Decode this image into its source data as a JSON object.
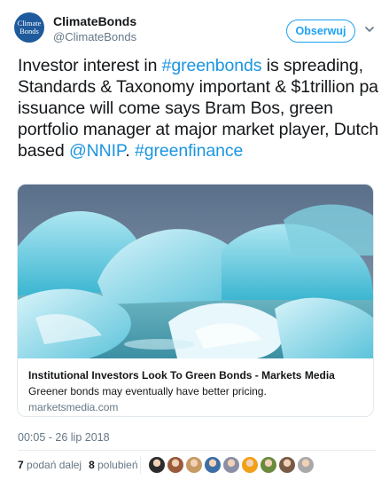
{
  "author": {
    "avatar_text_line1": "Climate",
    "avatar_text_line2": "Bonds",
    "display_name": "ClimateBonds",
    "handle": "@ClimateBonds"
  },
  "follow_button": {
    "label": "Obserwuj"
  },
  "menu_icon": "chevron-down-icon",
  "tweet": {
    "text_1": "Investor interest in ",
    "hashtag_1": "#greenbonds",
    "text_2": " is spreading, Standards & Taxonomy important & $1trillion pa issuance will come says Bram Bos, green portfolio manager at major market player, Dutch based ",
    "mention": "@NNIP",
    "text_3": ". ",
    "hashtag_2": "#greenfinance"
  },
  "link_card": {
    "title": "Institutional Investors Look To Green Bonds - Markets Media",
    "description": "Greener bonds may eventually have better pricing.",
    "domain": "marketsmedia.com"
  },
  "timestamp": "00:05 - 26 lip 2018",
  "stats": {
    "retweets_count": "7",
    "retweets_label": "podań dalej",
    "likes_count": "8",
    "likes_label": "polubień"
  },
  "likers": [
    {
      "name": "liker-avatar",
      "color": "#2c2c2c"
    },
    {
      "name": "liker-avatar",
      "color": "#9a5a3c"
    },
    {
      "name": "liker-avatar",
      "color": "#c79a63"
    },
    {
      "name": "liker-avatar",
      "color": "#3b6ea5"
    },
    {
      "name": "liker-avatar",
      "color": "#8a8fa6"
    },
    {
      "name": "liker-avatar",
      "color": "#f0a019"
    },
    {
      "name": "liker-avatar",
      "color": "#6c8a3e"
    },
    {
      "name": "liker-avatar",
      "color": "#7a5b46"
    },
    {
      "name": "liker-avatar",
      "color": "#a9a9a9"
    }
  ],
  "colors": {
    "accent": "#1da1f2",
    "link": "#1b95e0",
    "text": "#14171a",
    "muted": "#657786",
    "border": "#e1e8ed"
  }
}
